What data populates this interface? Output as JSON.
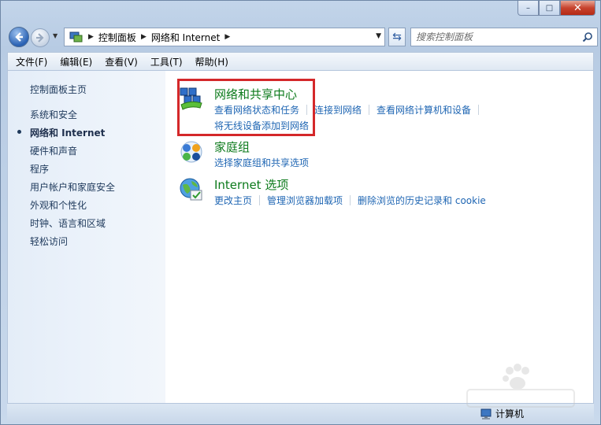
{
  "window": {
    "caption": {
      "minimize": "–",
      "maximize": "□",
      "close": "✕"
    }
  },
  "address": {
    "crumbs": [
      "控制面板",
      "网络和 Internet"
    ],
    "search_placeholder": "搜索控制面板"
  },
  "menu": [
    "文件(F)",
    "编辑(E)",
    "查看(V)",
    "工具(T)",
    "帮助(H)"
  ],
  "sidebar": {
    "home": "控制面板主页",
    "items": [
      "系统和安全",
      "网络和 Internet",
      "硬件和声音",
      "程序",
      "用户帐户和家庭安全",
      "外观和个性化",
      "时钟、语言和区域",
      "轻松访问"
    ],
    "current_index": 1
  },
  "categories": [
    {
      "title": "网络和共享中心",
      "links": [
        "查看网络状态和任务",
        "连接到网络",
        "查看网络计算机和设备"
      ],
      "links_row2": [
        "将无线设备添加到网络"
      ],
      "icon": "network-sharing-icon"
    },
    {
      "title": "家庭组",
      "links": [
        "选择家庭组和共享选项"
      ],
      "icon": "homegroup-icon"
    },
    {
      "title": "Internet 选项",
      "links": [
        "更改主页",
        "管理浏览器加载项",
        "删除浏览的历史记录和 cookie"
      ],
      "icon": "internet-options-icon"
    }
  ],
  "status": {
    "computer": "计算机"
  },
  "colors": {
    "highlight": "#d4282a",
    "link": "#1f66b3",
    "category_title": "#0c7a1b"
  }
}
